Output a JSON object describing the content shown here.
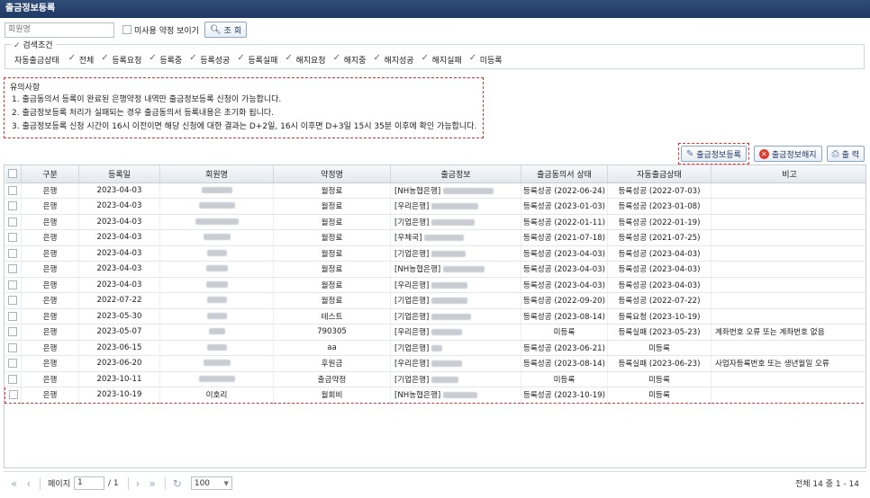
{
  "window_title": "출금정보등록",
  "search": {
    "placeholder": "회원명",
    "show_unused_label": "미사용 약정 보이기",
    "search_button": "조 회"
  },
  "filter": {
    "legend": "검색조건",
    "group_label": "자동출금상태",
    "options": [
      "전체",
      "등록요청",
      "등록중",
      "등록성공",
      "등록실패",
      "해지요청",
      "해지중",
      "해지성공",
      "해지실패",
      "미등록"
    ]
  },
  "notes": {
    "legend": "유의사항",
    "items": [
      "1. 출금동의서 등록이 완료된 은행약정 내역만 출금정보등록 신청이 가능합니다.",
      "2. 출금정보등록 처리가 실패되는 경우 출금동의서 등록내용은 초기화 됩니다.",
      "3. 출금정보등록 신청 시간이 16시 이전이면 해당 신청에 대한 결과는 D+2일, 16시 이후면 D+3일 15시 35분 이후에 확인 가능합니다."
    ]
  },
  "actions": {
    "register": "출금정보등록",
    "cancel": "출금정보해지",
    "print": "출 력"
  },
  "table": {
    "headers": [
      "구분",
      "등록일",
      "회원명",
      "약정명",
      "출금정보",
      "출금동의서 상태",
      "자동출금상태",
      "비고"
    ],
    "rows": [
      {
        "type": "은행",
        "date": "2023-04-03",
        "member": "",
        "plan": "월정료",
        "info": "[NH농협은행] ",
        "consent": "등록성공 (2022-06-24)",
        "auto": "등록성공 (2022-07-03)",
        "note": ""
      },
      {
        "type": "은행",
        "date": "2023-04-03",
        "member": "",
        "plan": "월정료",
        "info": "[우리은행] ",
        "consent": "등록성공 (2023-01-03)",
        "auto": "등록성공 (2023-01-08)",
        "note": ""
      },
      {
        "type": "은행",
        "date": "2023-04-03",
        "member": "",
        "plan": "월정료",
        "info": "[기업은행] ",
        "consent": "등록성공 (2022-01-11)",
        "auto": "등록성공 (2022-01-19)",
        "note": ""
      },
      {
        "type": "은행",
        "date": "2023-04-03",
        "member": "",
        "plan": "월정료",
        "info": "[우체국] ",
        "consent": "등록성공 (2021-07-18)",
        "auto": "등록성공 (2021-07-25)",
        "note": ""
      },
      {
        "type": "은행",
        "date": "2023-04-03",
        "member": "",
        "plan": "월정료",
        "info": "[기업은행] ",
        "consent": "등록성공 (2023-04-03)",
        "auto": "등록성공 (2023-04-03)",
        "note": ""
      },
      {
        "type": "은행",
        "date": "2023-04-03",
        "member": "",
        "plan": "월정료",
        "info": "[NH농협은행] ",
        "consent": "등록성공 (2023-04-03)",
        "auto": "등록성공 (2023-04-03)",
        "note": ""
      },
      {
        "type": "은행",
        "date": "2023-04-03",
        "member": "",
        "plan": "월정료",
        "info": "[우리은행] ",
        "consent": "등록성공 (2023-04-03)",
        "auto": "등록성공 (2023-04-03)",
        "note": ""
      },
      {
        "type": "은행",
        "date": "2022-07-22",
        "member": "",
        "plan": "월정료",
        "info": "[기업은행] ",
        "consent": "등록성공 (2022-09-20)",
        "auto": "등록성공 (2022-07-22)",
        "note": ""
      },
      {
        "type": "은행",
        "date": "2023-05-30",
        "member": "",
        "plan": "테스트",
        "info": "[기업은행] ",
        "consent": "등록성공 (2023-08-14)",
        "auto": "등록요청 (2023-10-19)",
        "note": ""
      },
      {
        "type": "은행",
        "date": "2023-05-07",
        "member": "",
        "plan": "790305",
        "info": "[우리은행] ",
        "consent": "미등록",
        "auto": "등록실패 (2023-05-23)",
        "note": "계좌번호 오류 또는 계좌번호 없음"
      },
      {
        "type": "은행",
        "date": "2023-06-15",
        "member": "",
        "plan": "aa",
        "info": "[기업은행] ",
        "consent": "등록성공 (2023-06-21)",
        "auto": "미등록",
        "note": ""
      },
      {
        "type": "은행",
        "date": "2023-06-20",
        "member": "",
        "plan": "후원금",
        "info": "[우리은행] ",
        "consent": "등록성공 (2023-08-14)",
        "auto": "등록실패 (2023-06-23)",
        "note": "사업자등록번호 또는 생년월일 오류"
      },
      {
        "type": "은행",
        "date": "2023-10-11",
        "member": "",
        "plan": "출금약정",
        "info": "[기업은행] ",
        "consent": "미등록",
        "auto": "미등록",
        "note": ""
      },
      {
        "type": "은행",
        "date": "2023-10-19",
        "member": "이호리",
        "plan": "월회비",
        "info": "[NH농협은행] ",
        "consent": "등록성공 (2023-10-19)",
        "auto": "미등록",
        "note": ""
      }
    ]
  },
  "pager": {
    "page_label": "페이지",
    "page_value": "1",
    "total_pages": "/ 1",
    "page_size": "100",
    "summary": "전체 14 중 1 - 14"
  }
}
